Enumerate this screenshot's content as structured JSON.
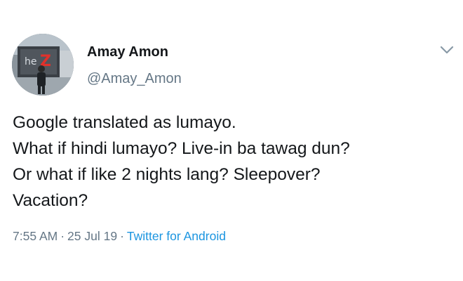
{
  "author": {
    "display_name": "Amay Amon",
    "handle": "@Amay_Amon",
    "avatar_icon": "profile-photo"
  },
  "tweet": {
    "lines": [
      "Google translated as lumayo.",
      "What if hindi lumayo? Live-in ba tawag dun?",
      "Or what if like 2 nights lang? Sleepover?",
      "Vacation?"
    ]
  },
  "meta": {
    "time": "7:55 AM",
    "separator": "·",
    "date": "25 Jul 19",
    "source": "Twitter for Android"
  },
  "menu": {
    "icon": "chevron-down-icon"
  },
  "colors": {
    "text": "#14171a",
    "secondary": "#657786",
    "link": "#1b95e0"
  }
}
